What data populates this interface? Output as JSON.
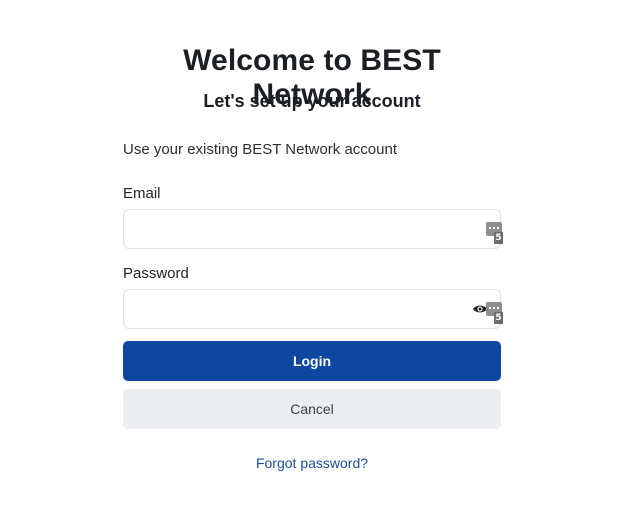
{
  "header": {
    "title": "Welcome to BEST Network",
    "subtitle": "Let's set up your account"
  },
  "intro_text": "Use your existing BEST Network account",
  "form": {
    "email_label": "Email",
    "email_value": "",
    "password_label": "Password",
    "password_value": "",
    "password_manager_badge": "5"
  },
  "buttons": {
    "login_label": "Login",
    "cancel_label": "Cancel"
  },
  "links": {
    "forgot_password": "Forgot password?"
  },
  "colors": {
    "primary": "#0d47a1",
    "cancel_bg": "#ebedf0",
    "link": "#1a4f9c"
  },
  "icons": {
    "password_manager": "password-manager-icon",
    "show_password": "eye-icon"
  }
}
